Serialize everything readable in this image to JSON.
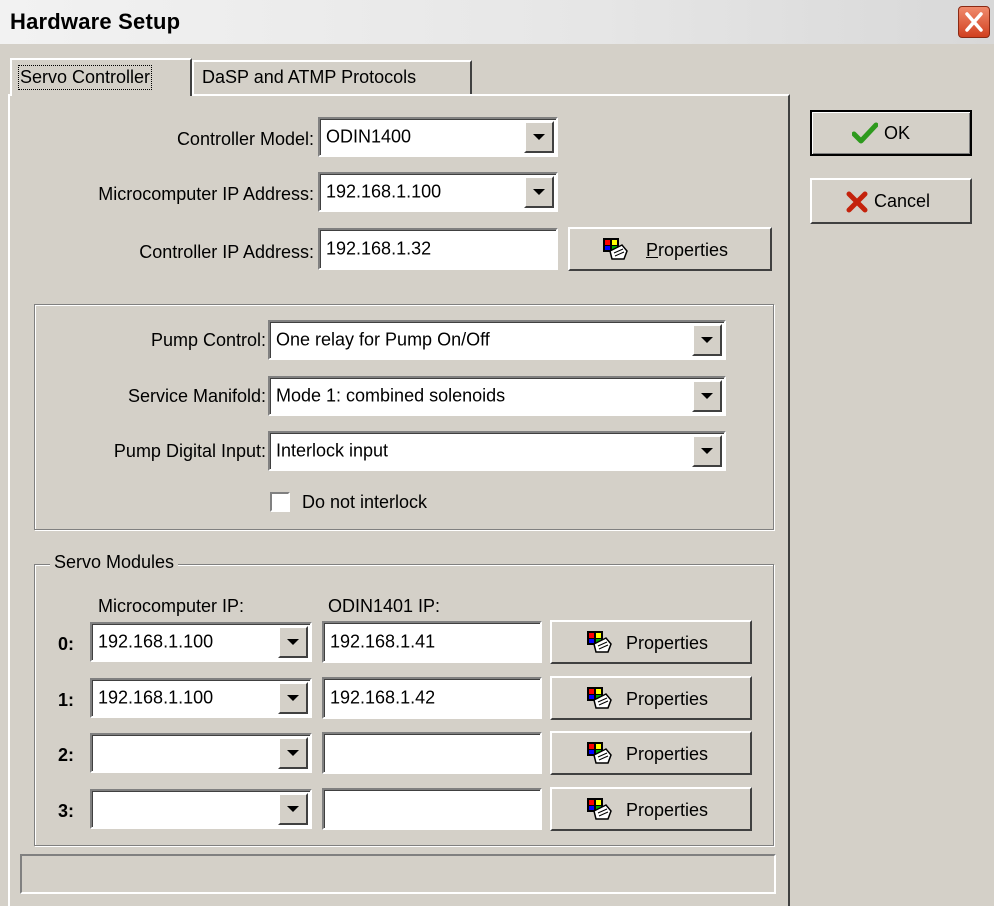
{
  "window": {
    "title": "Hardware Setup",
    "close_icon": "close-icon"
  },
  "tabs": [
    {
      "label": "Servo Controller",
      "active": true
    },
    {
      "label": "DaSP and ATMP Protocols",
      "active": false
    }
  ],
  "buttons": {
    "ok": "OK",
    "cancel": "Cancel"
  },
  "controller": {
    "model_label": "Controller Model:",
    "model_value": "ODIN1400",
    "micro_ip_label": "Microcomputer IP Address:",
    "micro_ip_value": "192.168.1.100",
    "ctrl_ip_label": "Controller IP Address:",
    "ctrl_ip_value": "192.168.1.32",
    "properties": "Properties"
  },
  "pump": {
    "control_label": "Pump Control:",
    "control_value": "One relay for Pump On/Off",
    "manifold_label": "Service Manifold:",
    "manifold_value": "Mode 1: combined solenoids",
    "digital_label": "Pump Digital Input:",
    "digital_value": "Interlock input",
    "interlock_label": "Do not interlock",
    "interlock_checked": false
  },
  "servo": {
    "group_label": "Servo Modules",
    "col_micro": "Microcomputer IP:",
    "col_odin": "ODIN1401 IP:",
    "rows": [
      {
        "num": "0:",
        "micro": "192.168.1.100",
        "odin": "192.168.1.41",
        "btn": "Properties"
      },
      {
        "num": "1:",
        "micro": "192.168.1.100",
        "odin": "192.168.1.42",
        "btn": "Properties"
      },
      {
        "num": "2:",
        "micro": "",
        "odin": "",
        "btn": "Properties"
      },
      {
        "num": "3:",
        "micro": "",
        "odin": "",
        "btn": "Properties"
      }
    ]
  },
  "colors": {
    "face": "#d4d0c8",
    "ok_check": "#2e9a1e",
    "cancel_x": "#c4220c",
    "close": "#d1401f"
  }
}
